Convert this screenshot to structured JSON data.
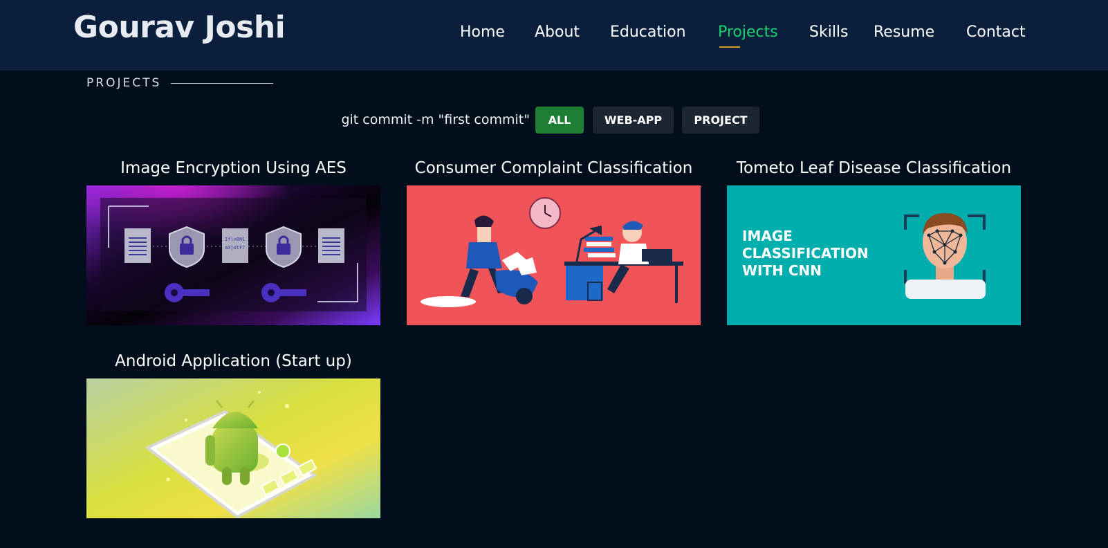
{
  "header": {
    "logo": "Gourav Joshi",
    "nav": [
      {
        "label": "Home"
      },
      {
        "label": "About"
      },
      {
        "label": "Education"
      },
      {
        "label": "Projects",
        "active": true
      },
      {
        "label": "Skills"
      },
      {
        "label": "Resume"
      },
      {
        "label": "Contact"
      }
    ]
  },
  "section": {
    "title": "PROJECTS"
  },
  "filters": {
    "label": "git commit -m \"first commit\"",
    "buttons": [
      {
        "label": "ALL",
        "active": true
      },
      {
        "label": "WEB-APP"
      },
      {
        "label": "PROJECT"
      }
    ]
  },
  "projects": [
    {
      "title": "Image Encryption Using AES",
      "image": "aes-encryption-illustration"
    },
    {
      "title": "Consumer Complaint Classification",
      "image": "office-complaint-illustration"
    },
    {
      "title": "Tometo Leaf Disease Classification",
      "image": "cnn-face-recognition-illustration",
      "image_text": [
        "IMAGE",
        "CLASSIFICATION",
        "WITH CNN"
      ]
    },
    {
      "title": "Android Application (Start up)",
      "image": "android-phone-illustration"
    }
  ],
  "colors": {
    "header_bg": "#0a1f3b",
    "page_bg": "#010e1b",
    "accent_green": "#18d26e",
    "active_filter": "#1e7e34",
    "filter_bg": "#1c2632"
  }
}
